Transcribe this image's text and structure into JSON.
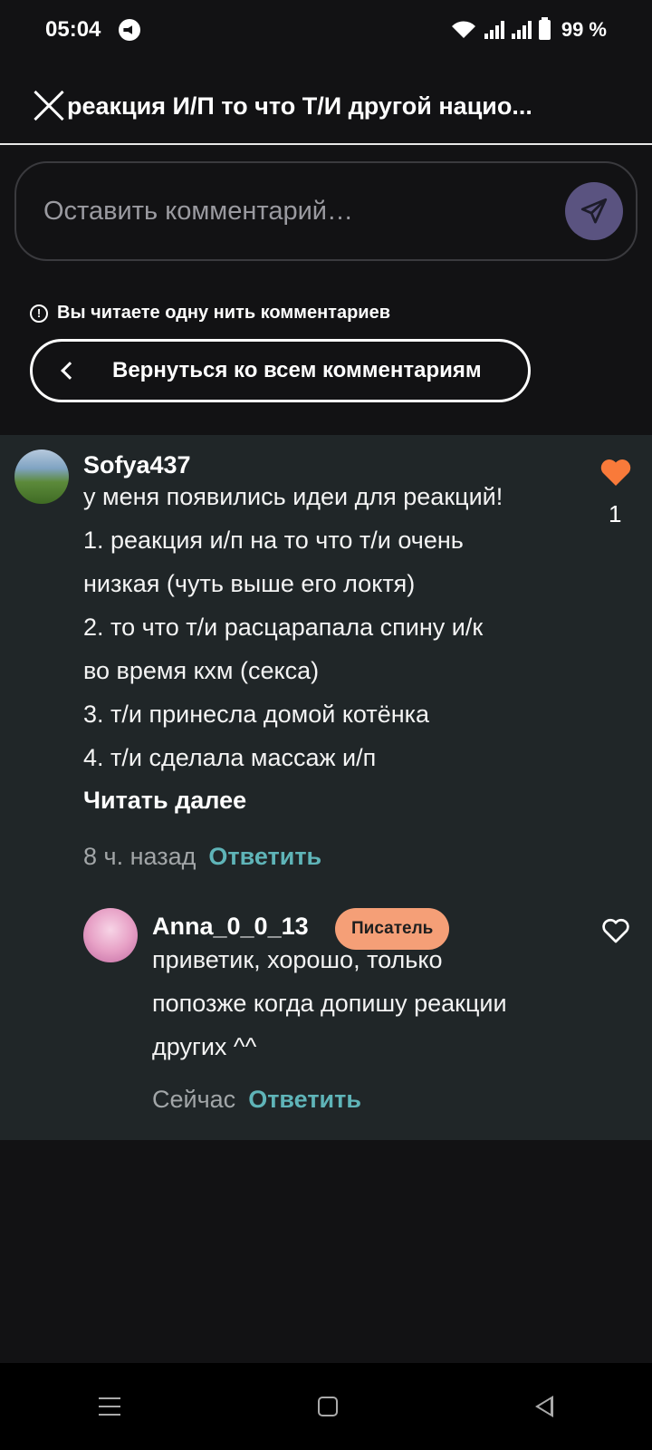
{
  "status_bar": {
    "time": "05:04",
    "battery": "99 %"
  },
  "header": {
    "title": "реакция И/П то что Т/И другой нацио..."
  },
  "comment_input": {
    "placeholder": "Оставить комментарий…"
  },
  "thread_notice": "Вы читаете одну нить комментариев",
  "back_button": "Вернуться ко всем комментариям",
  "comments": [
    {
      "username": "Sofya437",
      "lines": [
        "у меня появились идеи для реакций!",
        "1. реакция и/п на то что т/и очень",
        "низкая (чуть выше его локтя)",
        "2. то что т/и расцарапала спину и/к",
        "во время кхм (секса)",
        "3. т/и принесла домой котёнка",
        "4. т/и сделала массаж и/п"
      ],
      "read_more": "Читать далее",
      "time": "8 ч. назад",
      "reply": "Ответить",
      "likes": "1"
    },
    {
      "username": "Anna_0_0_13",
      "badge": "Писатель",
      "lines": [
        "приветик, хорошо, только",
        "попозже когда допишу реакции",
        "других ^^"
      ],
      "time": "Сейчас",
      "reply": "Ответить"
    }
  ],
  "colors": {
    "accent_heart": "#f97a3a",
    "reply_link": "#5fb4b8",
    "badge_bg": "#f59f77"
  }
}
